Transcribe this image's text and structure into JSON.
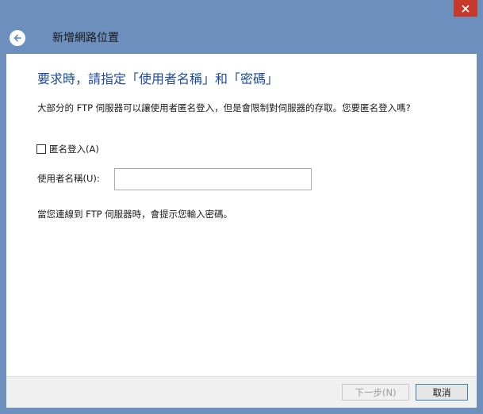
{
  "window": {
    "close_symbol": "×"
  },
  "header": {
    "title": "新增網路位置",
    "back_icon": "arrow-left-circle-icon"
  },
  "main": {
    "heading": "要求時，請指定「使用者名稱」和「密碼」",
    "description": "大部分的 FTP 伺服器可以讓使用者匿名登入，但是會限制對伺服器的存取。您要匿名登入嗎?",
    "anonymous_checkbox": {
      "label": "匿名登入(A)",
      "checked": false
    },
    "username": {
      "label": "使用者名稱(U):",
      "value": "",
      "placeholder": ""
    },
    "note": "當您連線到 FTP 伺服器時，會提示您輸入密碼。"
  },
  "footer": {
    "next_label": "下一步(N)",
    "next_enabled": false,
    "cancel_label": "取消"
  },
  "colors": {
    "frame": "#6d8fbd",
    "close": "#c7392b",
    "heading": "#1e4a9e"
  }
}
